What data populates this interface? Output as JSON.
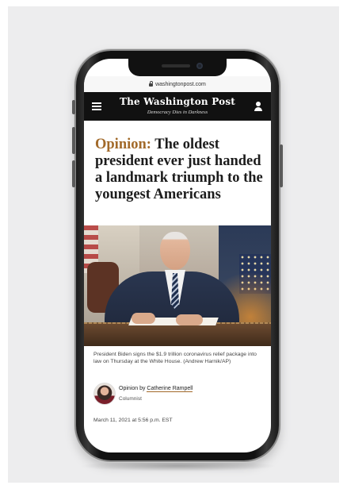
{
  "browser": {
    "url": "washingtonpost.com"
  },
  "masthead": {
    "logo": "The Washington Post",
    "tagline": "Democracy Dies in Darkness",
    "menu_icon": "hamburger-menu-icon",
    "account_icon": "user-account-icon"
  },
  "article": {
    "kicker": "Opinion:",
    "headline": "The oldest president ever just handed a landmark triumph to the youngest Americans",
    "photo_caption": "President Biden signs the $1.9 trillion coronavirus relief package into law on Thursday at the White House. (Andrew Harnik/AP)",
    "byline_prefix": "Opinion by",
    "author": "Catherine Rampell",
    "author_role": "Columnist",
    "published": "March 11, 2021 at 5:56 p.m. EST"
  },
  "colors": {
    "kicker": "#a26a2a",
    "masthead_bg": "#111111",
    "headline": "#1c1c1c"
  }
}
